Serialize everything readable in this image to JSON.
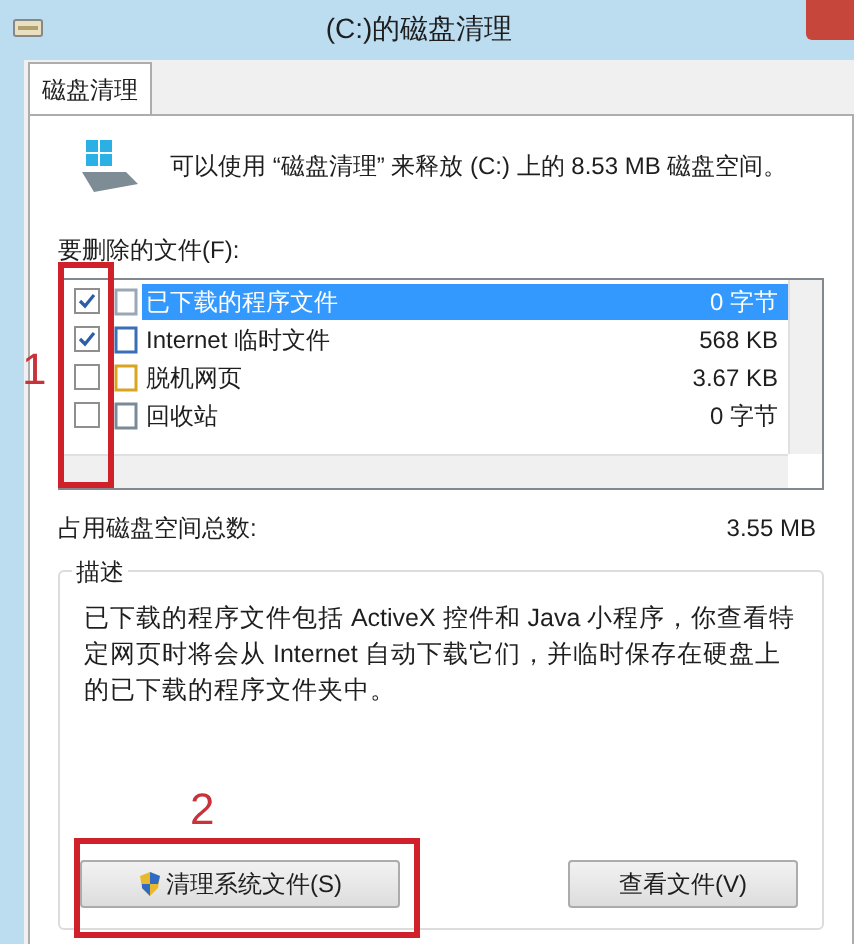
{
  "window": {
    "title": "(C:)的磁盘清理"
  },
  "tabs": [
    {
      "label": "磁盘清理",
      "selected": true
    }
  ],
  "summary": "可以使用 “磁盘清理” 来释放 (C:) 上的 8.53 MB 磁盘空间。",
  "files_label": "要删除的文件(F):",
  "files": [
    {
      "name": "已下载的程序文件",
      "size": "0 字节",
      "checked": true,
      "selected": true
    },
    {
      "name": "Internet 临时文件",
      "size": "568 KB",
      "checked": true,
      "selected": false
    },
    {
      "name": "脱机网页",
      "size": "3.67 KB",
      "checked": false,
      "selected": false
    },
    {
      "name": "回收站",
      "size": "0 字节",
      "checked": false,
      "selected": false
    }
  ],
  "total": {
    "label": "占用磁盘空间总数:",
    "value": "3.55 MB"
  },
  "description": {
    "title": "描述",
    "text": "已下载的程序文件包括 ActiveX 控件和 Java 小程序，你查看特定网页时将会从 Internet 自动下载它们，并临时保存在硬盘上的已下载的程序文件夹中。"
  },
  "buttons": [
    {
      "label": "清理系统文件(S)",
      "kind": "shield"
    },
    {
      "label": "查看文件(V)",
      "kind": "plain"
    }
  ],
  "annotations": [
    {
      "label": "1"
    },
    {
      "label": "2"
    }
  ]
}
